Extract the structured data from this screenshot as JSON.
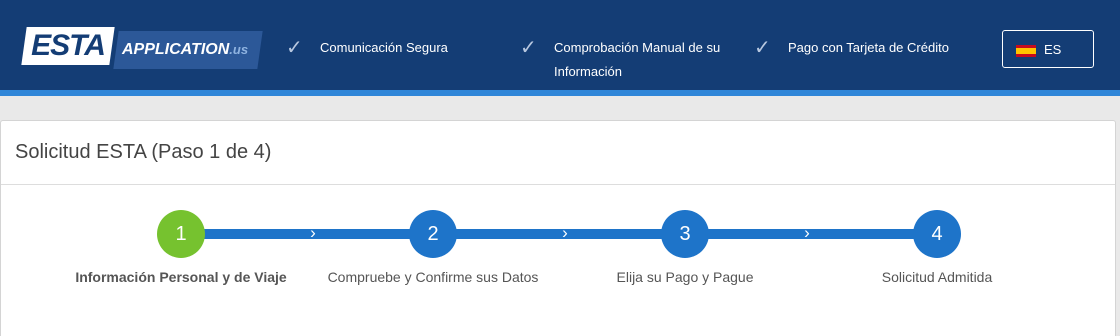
{
  "header": {
    "logo": {
      "esta": "ESTA",
      "application": "APPLICATION",
      "tld": ".us"
    },
    "features": [
      {
        "icon": "check-icon",
        "line1": "Comunicación Segura",
        "line2": ""
      },
      {
        "icon": "check-icon",
        "line1": "Comprobación Manual de su",
        "line2": "Información"
      },
      {
        "icon": "check-icon",
        "line1": "Pago con Tarjeta de Crédito",
        "line2": ""
      }
    ],
    "language": {
      "icon": "spain-flag-icon",
      "code": "ES"
    }
  },
  "card": {
    "title": "Solicitud ESTA (Paso 1 de 4)"
  },
  "steps": [
    {
      "number": "1",
      "label": "Información Personal y de Viaje",
      "active": true
    },
    {
      "number": "2",
      "label": "Compruebe y Confirme sus Datos",
      "active": false
    },
    {
      "number": "3",
      "label": "Elija su Pago y Pague",
      "active": false
    },
    {
      "number": "4",
      "label": "Solicitud Admitida",
      "active": false
    }
  ],
  "colors": {
    "header_bg": "#143d75",
    "header_stripe": "#2f86d8",
    "step_active": "#76c22f",
    "step_inactive": "#1e74c9"
  }
}
